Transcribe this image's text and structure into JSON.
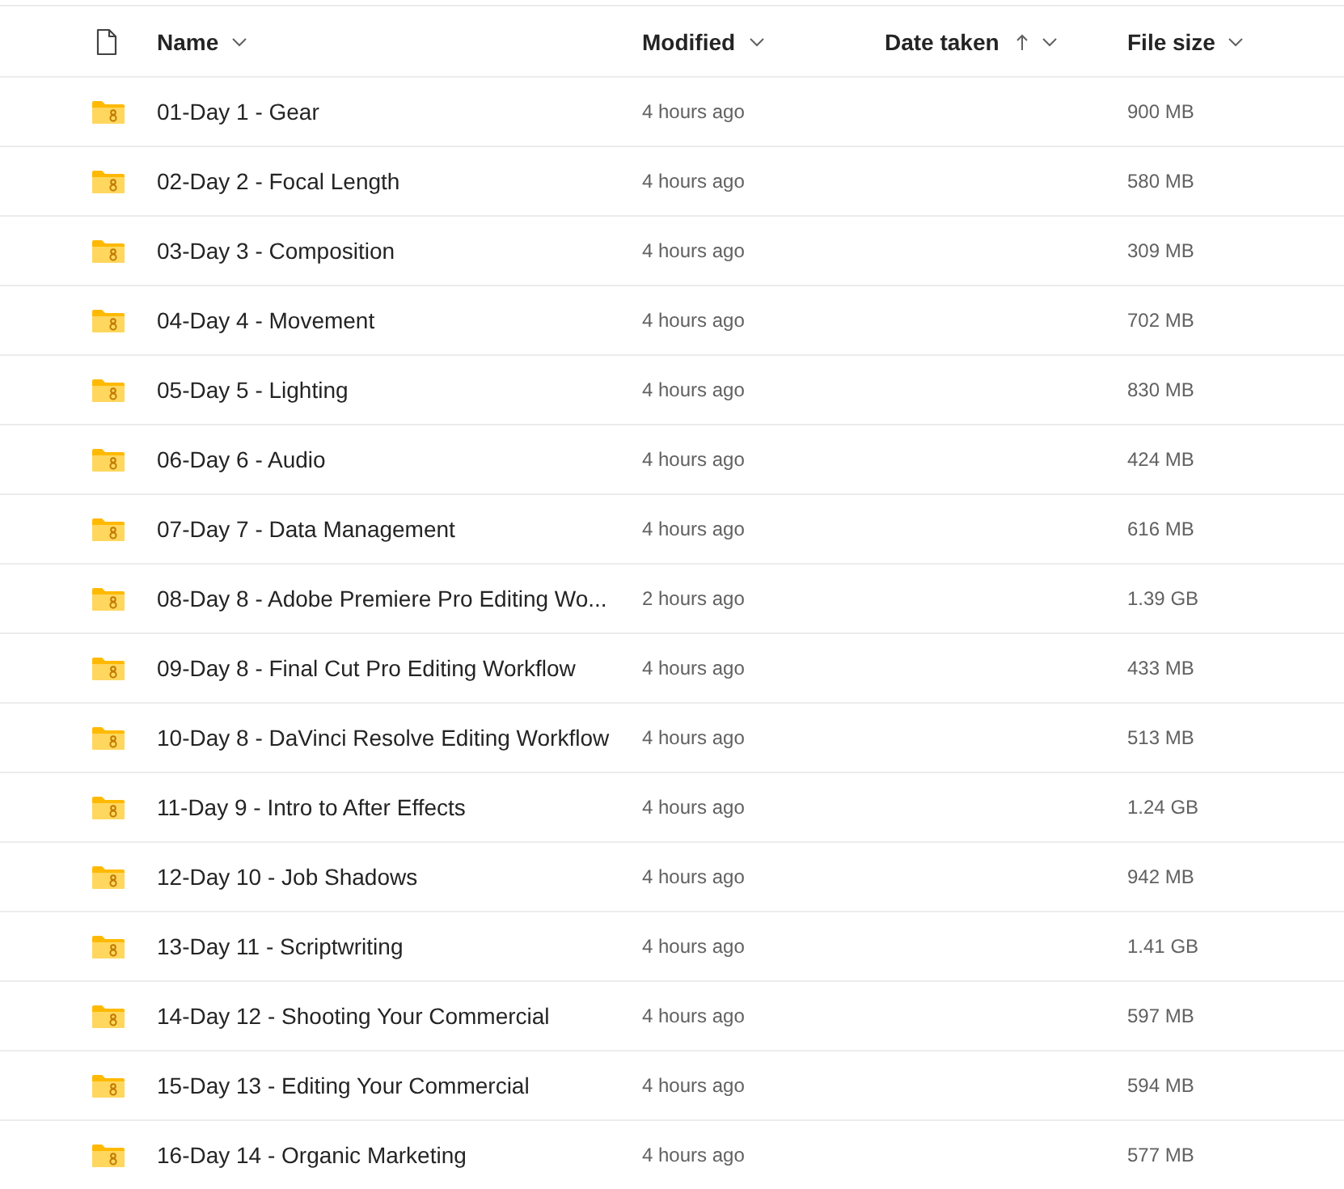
{
  "columns": [
    {
      "label": "Name",
      "sorted": false
    },
    {
      "label": "Modified",
      "sorted": false
    },
    {
      "label": "Date taken",
      "sorted": true
    },
    {
      "label": "File size",
      "sorted": false
    }
  ],
  "rows": [
    {
      "name": "01-Day 1 - Gear",
      "modified": "4 hours ago",
      "size": "900 MB"
    },
    {
      "name": "02-Day 2 - Focal Length",
      "modified": "4 hours ago",
      "size": "580 MB"
    },
    {
      "name": "03-Day 3 - Composition",
      "modified": "4 hours ago",
      "size": "309 MB"
    },
    {
      "name": "04-Day 4 - Movement",
      "modified": "4 hours ago",
      "size": "702 MB"
    },
    {
      "name": "05-Day 5 - Lighting",
      "modified": "4 hours ago",
      "size": "830 MB"
    },
    {
      "name": "06-Day 6 - Audio",
      "modified": "4 hours ago",
      "size": "424 MB"
    },
    {
      "name": "07-Day 7 - Data Management",
      "modified": "4 hours ago",
      "size": "616 MB"
    },
    {
      "name": "08-Day 8 - Adobe Premiere Pro Editing Wo...",
      "modified": "2 hours ago",
      "size": "1.39 GB"
    },
    {
      "name": "09-Day 8 - Final Cut Pro Editing Workflow",
      "modified": "4 hours ago",
      "size": "433 MB"
    },
    {
      "name": "10-Day 8 - DaVinci Resolve Editing Workflow",
      "modified": "4 hours ago",
      "size": "513 MB"
    },
    {
      "name": "11-Day 9 - Intro to After Effects",
      "modified": "4 hours ago",
      "size": "1.24 GB"
    },
    {
      "name": "12-Day 10 - Job Shadows",
      "modified": "4 hours ago",
      "size": "942 MB"
    },
    {
      "name": "13-Day 11 - Scriptwriting",
      "modified": "4 hours ago",
      "size": "1.41 GB"
    },
    {
      "name": "14-Day 12 - Shooting Your Commercial",
      "modified": "4 hours ago",
      "size": "597 MB"
    },
    {
      "name": "15-Day 13 - Editing Your Commercial",
      "modified": "4 hours ago",
      "size": "594 MB"
    },
    {
      "name": "16-Day 14 - Organic Marketing",
      "modified": "4 hours ago",
      "size": "577 MB"
    }
  ]
}
